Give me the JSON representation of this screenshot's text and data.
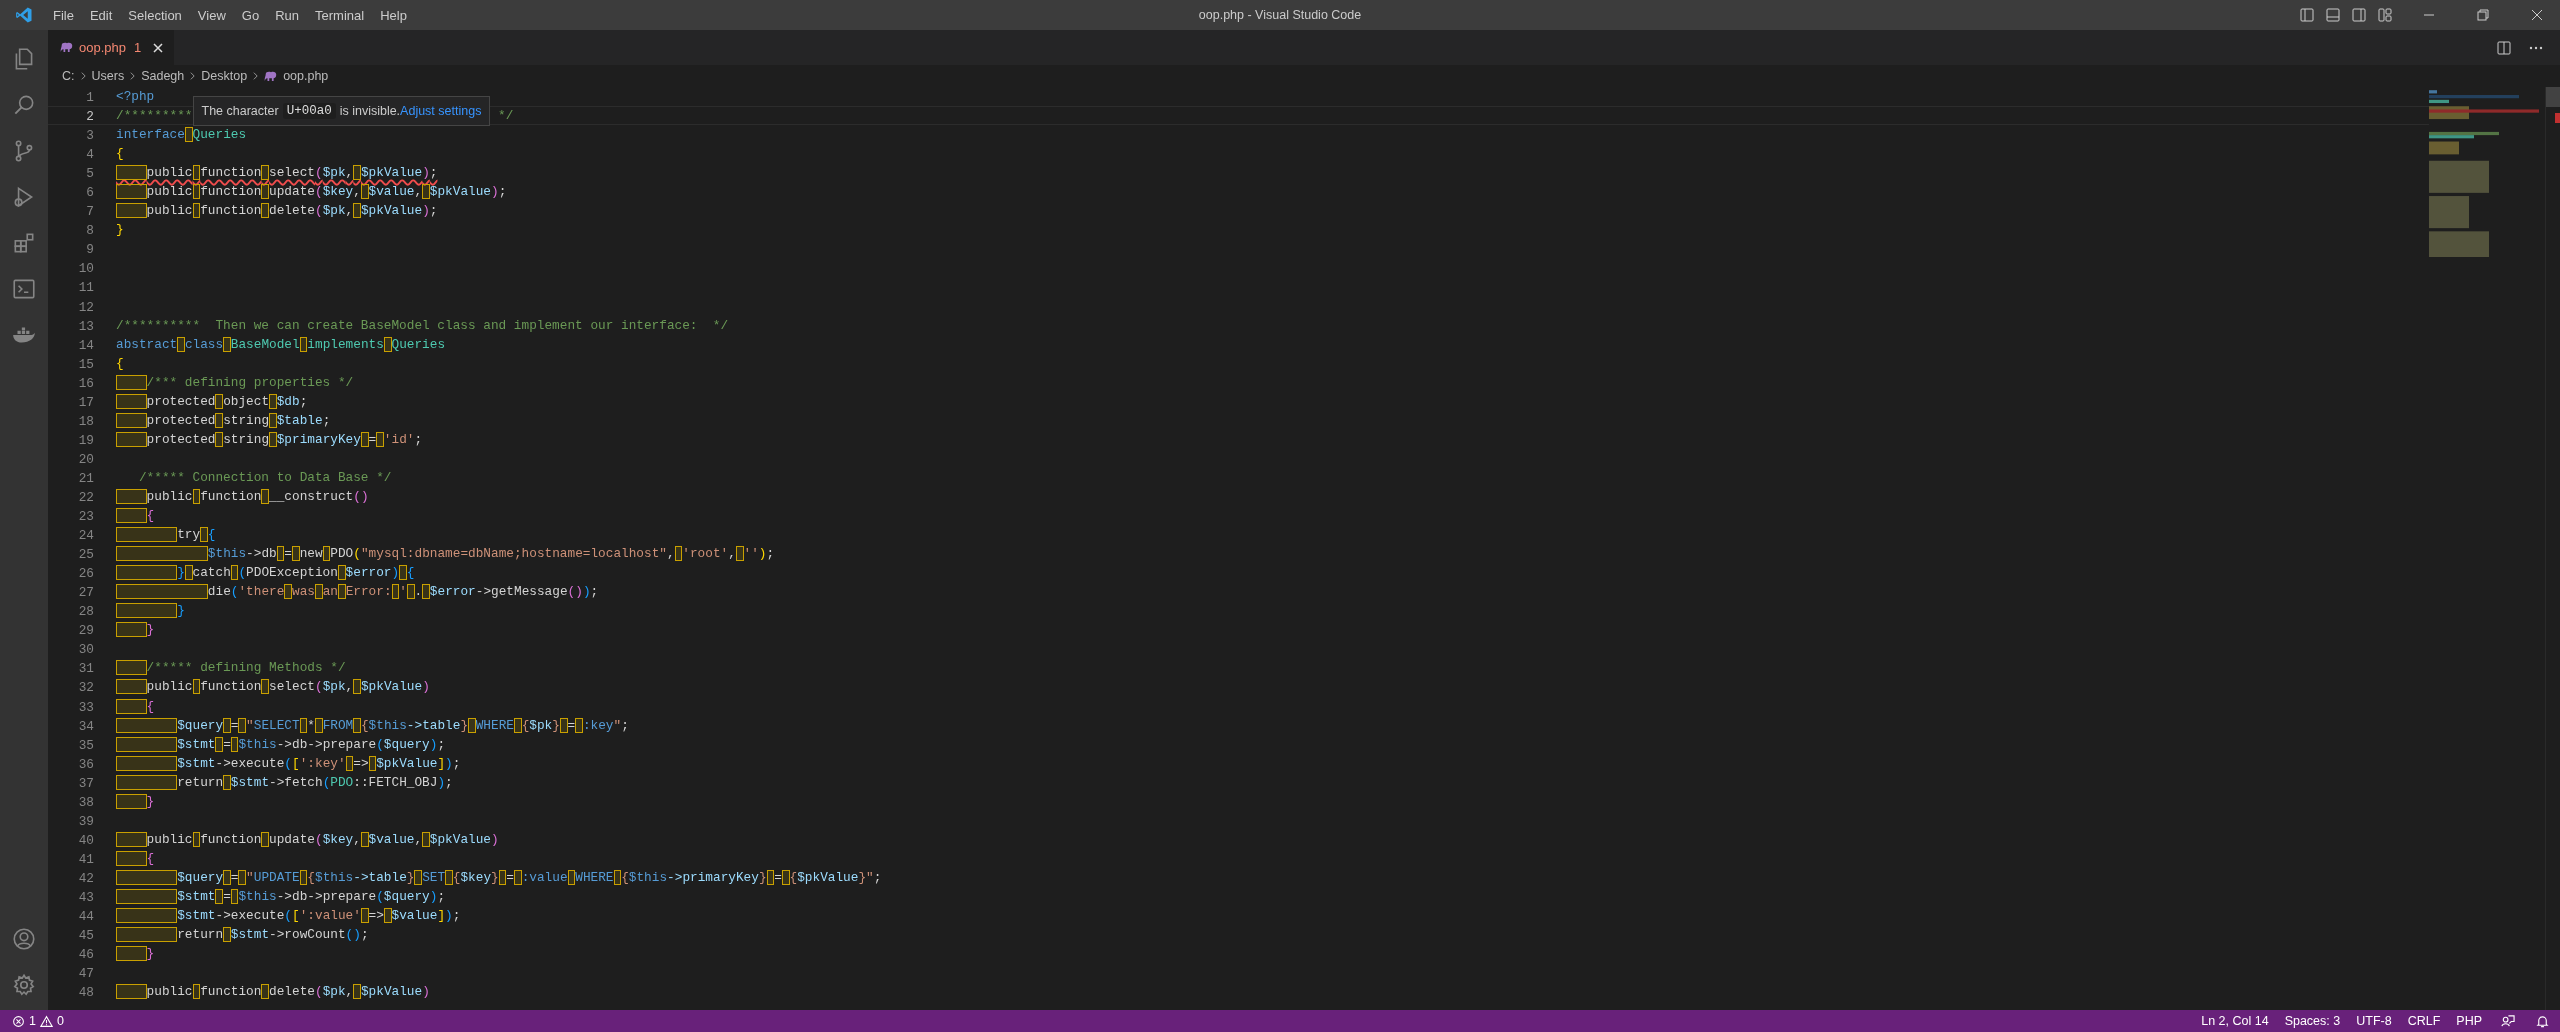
{
  "title_bar": {
    "menu": [
      "File",
      "Edit",
      "Selection",
      "View",
      "Go",
      "Run",
      "Terminal",
      "Help"
    ],
    "title": "oop.php - Visual Studio Code"
  },
  "tabs": [
    {
      "label": "oop.php",
      "problems": "1",
      "selected": true
    }
  ],
  "breadcrumb": [
    "C:",
    "Users",
    "Sadegh",
    "Desktop",
    "oop.php"
  ],
  "hover_tooltip": {
    "before": "The character",
    "code": "U+00a0",
    "after": "is invisible.",
    "link": "Adjust settings"
  },
  "editor": {
    "lines": [
      {
        "n": "1",
        "active": false,
        "error": false,
        "tokens": [
          {
            "kind": "kw",
            "t": "<?php"
          }
        ]
      },
      {
        "n": "2",
        "active": true,
        "error": false,
        "tokens": [
          {
            "kind": "com",
            "t": "/*********"
          },
          {
            "kind": "tooltip"
          },
          {
            "kind": "com",
            "t": " */"
          }
        ]
      },
      {
        "n": "3",
        "active": false,
        "error": false,
        "tokens": [
          {
            "kind": "kw",
            "t": "interface"
          },
          {
            "kind": "nb1"
          },
          {
            "kind": "ty",
            "t": "Queries"
          }
        ]
      },
      {
        "n": "4",
        "active": false,
        "error": false,
        "tokens": [
          {
            "kind": "b1",
            "t": "{"
          }
        ]
      },
      {
        "n": "5",
        "active": false,
        "error": true,
        "tokens": [
          {
            "kind": "nb4"
          },
          {
            "kind": "pl",
            "t": "public"
          },
          {
            "kind": "nb1"
          },
          {
            "kind": "pl",
            "t": "function"
          },
          {
            "kind": "nb1"
          },
          {
            "kind": "pl",
            "t": "select"
          },
          {
            "kind": "b2",
            "t": "("
          },
          {
            "kind": "var",
            "t": "$pk"
          },
          {
            "kind": "pl",
            "t": ","
          },
          {
            "kind": "nb1"
          },
          {
            "kind": "var",
            "t": "$pkValue"
          },
          {
            "kind": "b2",
            "t": ")"
          },
          {
            "kind": "pl",
            "t": ";"
          }
        ]
      },
      {
        "n": "6",
        "active": false,
        "error": false,
        "tokens": [
          {
            "kind": "nb4"
          },
          {
            "kind": "pl",
            "t": "public"
          },
          {
            "kind": "nb1"
          },
          {
            "kind": "pl",
            "t": "function"
          },
          {
            "kind": "nb1"
          },
          {
            "kind": "pl",
            "t": "update"
          },
          {
            "kind": "b2",
            "t": "("
          },
          {
            "kind": "var",
            "t": "$key"
          },
          {
            "kind": "pl",
            "t": ","
          },
          {
            "kind": "nb1"
          },
          {
            "kind": "var",
            "t": "$value"
          },
          {
            "kind": "pl",
            "t": ","
          },
          {
            "kind": "nb1"
          },
          {
            "kind": "var",
            "t": "$pkValue"
          },
          {
            "kind": "b2",
            "t": ")"
          },
          {
            "kind": "pl",
            "t": ";"
          }
        ]
      },
      {
        "n": "7",
        "active": false,
        "error": false,
        "tokens": [
          {
            "kind": "nb4"
          },
          {
            "kind": "pl",
            "t": "public"
          },
          {
            "kind": "nb1"
          },
          {
            "kind": "pl",
            "t": "function"
          },
          {
            "kind": "nb1"
          },
          {
            "kind": "pl",
            "t": "delete"
          },
          {
            "kind": "b2",
            "t": "("
          },
          {
            "kind": "var",
            "t": "$pk"
          },
          {
            "kind": "pl",
            "t": ","
          },
          {
            "kind": "nb1"
          },
          {
            "kind": "var",
            "t": "$pkValue"
          },
          {
            "kind": "b2",
            "t": ")"
          },
          {
            "kind": "pl",
            "t": ";"
          }
        ]
      },
      {
        "n": "8",
        "active": false,
        "error": false,
        "tokens": [
          {
            "kind": "b1",
            "t": "}"
          }
        ]
      },
      {
        "n": "9",
        "active": false,
        "error": false
      },
      {
        "n": "10",
        "active": false,
        "error": false
      },
      {
        "n": "11",
        "active": false,
        "error": false
      },
      {
        "n": "12",
        "active": false,
        "error": false
      },
      {
        "n": "13",
        "active": false,
        "error": false,
        "tokens": [
          {
            "kind": "com",
            "t": "/**********  Then we can create BaseModel class and implement our interface:  */"
          }
        ]
      },
      {
        "n": "14",
        "active": false,
        "error": false,
        "tokens": [
          {
            "kind": "kw",
            "t": "abstract"
          },
          {
            "kind": "nb1"
          },
          {
            "kind": "kw",
            "t": "class"
          },
          {
            "kind": "nb1"
          },
          {
            "kind": "ty",
            "t": "BaseModel"
          },
          {
            "kind": "nb1"
          },
          {
            "kind": "ty",
            "t": "implements"
          },
          {
            "kind": "nb1"
          },
          {
            "kind": "ty",
            "t": "Queries"
          }
        ]
      },
      {
        "n": "15",
        "active": false,
        "error": false,
        "tokens": [
          {
            "kind": "b1",
            "t": "{"
          }
        ]
      },
      {
        "n": "16",
        "active": false,
        "error": false,
        "tokens": [
          {
            "kind": "nb4"
          },
          {
            "kind": "com",
            "t": "/*** defining properties */"
          }
        ]
      },
      {
        "n": "17",
        "active": false,
        "error": false,
        "tokens": [
          {
            "kind": "nb4"
          },
          {
            "kind": "pl",
            "t": "protected"
          },
          {
            "kind": "nb1"
          },
          {
            "kind": "pl",
            "t": "object"
          },
          {
            "kind": "nb1"
          },
          {
            "kind": "var",
            "t": "$db"
          },
          {
            "kind": "pl",
            "t": ";"
          }
        ]
      },
      {
        "n": "18",
        "active": false,
        "error": false,
        "tokens": [
          {
            "kind": "nb4"
          },
          {
            "kind": "pl",
            "t": "protected"
          },
          {
            "kind": "nb1"
          },
          {
            "kind": "pl",
            "t": "string"
          },
          {
            "kind": "nb1"
          },
          {
            "kind": "var",
            "t": "$table"
          },
          {
            "kind": "pl",
            "t": ";"
          }
        ]
      },
      {
        "n": "19",
        "active": false,
        "error": false,
        "tokens": [
          {
            "kind": "nb4"
          },
          {
            "kind": "pl",
            "t": "protected"
          },
          {
            "kind": "nb1"
          },
          {
            "kind": "pl",
            "t": "string"
          },
          {
            "kind": "nb1"
          },
          {
            "kind": "var",
            "t": "$primaryKey"
          },
          {
            "kind": "nb1"
          },
          {
            "kind": "pl",
            "t": "="
          },
          {
            "kind": "nb1"
          },
          {
            "kind": "str",
            "t": "'id'"
          },
          {
            "kind": "pl",
            "t": ";"
          }
        ]
      },
      {
        "n": "20",
        "active": false,
        "error": false
      },
      {
        "n": "21",
        "active": false,
        "error": false,
        "tokens": [
          {
            "kind": "com",
            "t": "   /***** Connection to Data Base */"
          }
        ]
      },
      {
        "n": "22",
        "active": false,
        "error": false,
        "tokens": [
          {
            "kind": "nb4"
          },
          {
            "kind": "pl",
            "t": "public"
          },
          {
            "kind": "nb1"
          },
          {
            "kind": "pl",
            "t": "function"
          },
          {
            "kind": "nb1"
          },
          {
            "kind": "pl",
            "t": "__construct"
          },
          {
            "kind": "b2",
            "t": "()"
          }
        ]
      },
      {
        "n": "23",
        "active": false,
        "error": false,
        "tokens": [
          {
            "kind": "nb4"
          },
          {
            "kind": "b2",
            "t": "{"
          }
        ]
      },
      {
        "n": "24",
        "active": false,
        "error": false,
        "tokens": [
          {
            "kind": "nb8"
          },
          {
            "kind": "pl",
            "t": "try"
          },
          {
            "kind": "nb1"
          },
          {
            "kind": "b3",
            "t": "{"
          }
        ]
      },
      {
        "n": "25",
        "active": false,
        "error": false,
        "tokens": [
          {
            "kind": "nb12"
          },
          {
            "kind": "kw",
            "t": "$this"
          },
          {
            "kind": "pl",
            "t": "->db"
          },
          {
            "kind": "nb1"
          },
          {
            "kind": "pl",
            "t": "="
          },
          {
            "kind": "nb1"
          },
          {
            "kind": "pl",
            "t": "new"
          },
          {
            "kind": "nb1"
          },
          {
            "kind": "pl",
            "t": "PDO"
          },
          {
            "kind": "b1",
            "t": "("
          },
          {
            "kind": "str",
            "t": "\"mysql:dbname=dbName;hostname=localhost\""
          },
          {
            "kind": "pl",
            "t": ","
          },
          {
            "kind": "nb1"
          },
          {
            "kind": "str",
            "t": "'root'"
          },
          {
            "kind": "pl",
            "t": ","
          },
          {
            "kind": "nb1"
          },
          {
            "kind": "str",
            "t": "''"
          },
          {
            "kind": "b1",
            "t": ")"
          },
          {
            "kind": "pl",
            "t": ";"
          }
        ]
      },
      {
        "n": "26",
        "active": false,
        "error": false,
        "tokens": [
          {
            "kind": "nb8"
          },
          {
            "kind": "b3",
            "t": "}"
          },
          {
            "kind": "nb1"
          },
          {
            "kind": "pl",
            "t": "catch"
          },
          {
            "kind": "nb1"
          },
          {
            "kind": "b3",
            "t": "("
          },
          {
            "kind": "pl",
            "t": "PDOException"
          },
          {
            "kind": "nb1"
          },
          {
            "kind": "var",
            "t": "$error"
          },
          {
            "kind": "b3",
            "t": ")"
          },
          {
            "kind": "nb1"
          },
          {
            "kind": "b3",
            "t": "{"
          }
        ]
      },
      {
        "n": "27",
        "active": false,
        "error": false,
        "tokens": [
          {
            "kind": "nb12"
          },
          {
            "kind": "pl",
            "t": "die"
          },
          {
            "kind": "b3",
            "t": "("
          },
          {
            "kind": "str",
            "t": "'there"
          },
          {
            "kind": "nb1"
          },
          {
            "kind": "str",
            "t": "was"
          },
          {
            "kind": "nb1"
          },
          {
            "kind": "str",
            "t": "an"
          },
          {
            "kind": "nb1"
          },
          {
            "kind": "str",
            "t": "Error:"
          },
          {
            "kind": "nb1"
          },
          {
            "kind": "str",
            "t": "'"
          },
          {
            "kind": "nb1"
          },
          {
            "kind": "pl",
            "t": "."
          },
          {
            "kind": "nb1"
          },
          {
            "kind": "var",
            "t": "$error"
          },
          {
            "kind": "pl",
            "t": "->getMessage"
          },
          {
            "kind": "b2",
            "t": "()"
          },
          {
            "kind": "b3",
            "t": ")"
          },
          {
            "kind": "pl",
            "t": ";"
          }
        ]
      },
      {
        "n": "28",
        "active": false,
        "error": false,
        "tokens": [
          {
            "kind": "nb8"
          },
          {
            "kind": "b3",
            "t": "}"
          }
        ]
      },
      {
        "n": "29",
        "active": false,
        "error": false,
        "tokens": [
          {
            "kind": "nb4"
          },
          {
            "kind": "b2",
            "t": "}"
          }
        ]
      },
      {
        "n": "30",
        "active": false,
        "error": false
      },
      {
        "n": "31",
        "active": false,
        "error": false,
        "tokens": [
          {
            "kind": "nb4"
          },
          {
            "kind": "com",
            "t": "/***** defining Methods */"
          }
        ]
      },
      {
        "n": "32",
        "active": false,
        "error": false,
        "tokens": [
          {
            "kind": "nb4"
          },
          {
            "kind": "pl",
            "t": "public"
          },
          {
            "kind": "nb1"
          },
          {
            "kind": "pl",
            "t": "function"
          },
          {
            "kind": "nb1"
          },
          {
            "kind": "pl",
            "t": "select"
          },
          {
            "kind": "b2",
            "t": "("
          },
          {
            "kind": "var",
            "t": "$pk"
          },
          {
            "kind": "pl",
            "t": ","
          },
          {
            "kind": "nb1"
          },
          {
            "kind": "var",
            "t": "$pkValue"
          },
          {
            "kind": "b2",
            "t": ")"
          }
        ]
      },
      {
        "n": "33",
        "active": false,
        "error": false,
        "tokens": [
          {
            "kind": "nb4"
          },
          {
            "kind": "b2",
            "t": "{"
          }
        ]
      },
      {
        "n": "34",
        "active": false,
        "error": false,
        "tokens": [
          {
            "kind": "nb8"
          },
          {
            "kind": "var",
            "t": "$query"
          },
          {
            "kind": "nb1"
          },
          {
            "kind": "pl",
            "t": "="
          },
          {
            "kind": "nb1"
          },
          {
            "kind": "str",
            "t": "\""
          },
          {
            "kind": "kw",
            "t": "SELECT"
          },
          {
            "kind": "nb1"
          },
          {
            "kind": "pl",
            "t": "*"
          },
          {
            "kind": "nb1"
          },
          {
            "kind": "kw",
            "t": "FROM"
          },
          {
            "kind": "nb1"
          },
          {
            "kind": "str",
            "t": "{"
          },
          {
            "kind": "kw",
            "t": "$this"
          },
          {
            "kind": "var",
            "t": "->table"
          },
          {
            "kind": "str",
            "t": "}"
          },
          {
            "kind": "nb1"
          },
          {
            "kind": "kw",
            "t": "WHERE"
          },
          {
            "kind": "nb1"
          },
          {
            "kind": "str",
            "t": "{"
          },
          {
            "kind": "var",
            "t": "$pk"
          },
          {
            "kind": "str",
            "t": "}"
          },
          {
            "kind": "nb1"
          },
          {
            "kind": "pl",
            "t": "="
          },
          {
            "kind": "nb1"
          },
          {
            "kind": "kw",
            "t": ":key"
          },
          {
            "kind": "str",
            "t": "\""
          },
          {
            "kind": "pl",
            "t": ";"
          }
        ]
      },
      {
        "n": "35",
        "active": false,
        "error": false,
        "tokens": [
          {
            "kind": "nb8"
          },
          {
            "kind": "var",
            "t": "$stmt"
          },
          {
            "kind": "nb1"
          },
          {
            "kind": "pl",
            "t": "="
          },
          {
            "kind": "nb1"
          },
          {
            "kind": "kw",
            "t": "$this"
          },
          {
            "kind": "pl",
            "t": "->db->prepare"
          },
          {
            "kind": "b3",
            "t": "("
          },
          {
            "kind": "var",
            "t": "$query"
          },
          {
            "kind": "b3",
            "t": ")"
          },
          {
            "kind": "pl",
            "t": ";"
          }
        ]
      },
      {
        "n": "36",
        "active": false,
        "error": false,
        "tokens": [
          {
            "kind": "nb8"
          },
          {
            "kind": "var",
            "t": "$stmt"
          },
          {
            "kind": "pl",
            "t": "->execute"
          },
          {
            "kind": "b3",
            "t": "("
          },
          {
            "kind": "b1",
            "t": "["
          },
          {
            "kind": "str",
            "t": "':key'"
          },
          {
            "kind": "nb1"
          },
          {
            "kind": "pl",
            "t": "=>"
          },
          {
            "kind": "nb1"
          },
          {
            "kind": "var",
            "t": "$pkValue"
          },
          {
            "kind": "b1",
            "t": "]"
          },
          {
            "kind": "b3",
            "t": ")"
          },
          {
            "kind": "pl",
            "t": ";"
          }
        ]
      },
      {
        "n": "37",
        "active": false,
        "error": false,
        "tokens": [
          {
            "kind": "nb8"
          },
          {
            "kind": "pl",
            "t": "return"
          },
          {
            "kind": "nb1"
          },
          {
            "kind": "var",
            "t": "$stmt"
          },
          {
            "kind": "pl",
            "t": "->fetch"
          },
          {
            "kind": "b3",
            "t": "("
          },
          {
            "kind": "ty",
            "t": "PDO"
          },
          {
            "kind": "pl",
            "t": "::FETCH_OBJ"
          },
          {
            "kind": "b3",
            "t": ")"
          },
          {
            "kind": "pl",
            "t": ";"
          }
        ]
      },
      {
        "n": "38",
        "active": false,
        "error": false,
        "tokens": [
          {
            "kind": "nb4"
          },
          {
            "kind": "b2",
            "t": "}"
          }
        ]
      },
      {
        "n": "39",
        "active": false,
        "error": false
      },
      {
        "n": "40",
        "active": false,
        "error": false,
        "tokens": [
          {
            "kind": "nb4"
          },
          {
            "kind": "pl",
            "t": "public"
          },
          {
            "kind": "nb1"
          },
          {
            "kind": "pl",
            "t": "function"
          },
          {
            "kind": "nb1"
          },
          {
            "kind": "pl",
            "t": "update"
          },
          {
            "kind": "b2",
            "t": "("
          },
          {
            "kind": "var",
            "t": "$key"
          },
          {
            "kind": "pl",
            "t": ","
          },
          {
            "kind": "nb1"
          },
          {
            "kind": "var",
            "t": "$value"
          },
          {
            "kind": "pl",
            "t": ","
          },
          {
            "kind": "nb1"
          },
          {
            "kind": "var",
            "t": "$pkValue"
          },
          {
            "kind": "b2",
            "t": ")"
          }
        ]
      },
      {
        "n": "41",
        "active": false,
        "error": false,
        "tokens": [
          {
            "kind": "nb4"
          },
          {
            "kind": "b2",
            "t": "{"
          }
        ]
      },
      {
        "n": "42",
        "active": false,
        "error": false,
        "tokens": [
          {
            "kind": "nb8"
          },
          {
            "kind": "var",
            "t": "$query"
          },
          {
            "kind": "nb1"
          },
          {
            "kind": "pl",
            "t": "="
          },
          {
            "kind": "nb1"
          },
          {
            "kind": "str",
            "t": "\""
          },
          {
            "kind": "kw",
            "t": "UPDATE"
          },
          {
            "kind": "nb1"
          },
          {
            "kind": "str",
            "t": "{"
          },
          {
            "kind": "kw",
            "t": "$this"
          },
          {
            "kind": "var",
            "t": "->table"
          },
          {
            "kind": "str",
            "t": "}"
          },
          {
            "kind": "nb1"
          },
          {
            "kind": "kw",
            "t": "SET"
          },
          {
            "kind": "nb1"
          },
          {
            "kind": "str",
            "t": "{"
          },
          {
            "kind": "var",
            "t": "$key"
          },
          {
            "kind": "str",
            "t": "}"
          },
          {
            "kind": "nb1"
          },
          {
            "kind": "pl",
            "t": "="
          },
          {
            "kind": "nb1"
          },
          {
            "kind": "kw",
            "t": ":value"
          },
          {
            "kind": "nb1"
          },
          {
            "kind": "kw",
            "t": "WHERE"
          },
          {
            "kind": "nb1"
          },
          {
            "kind": "str",
            "t": "{"
          },
          {
            "kind": "kw",
            "t": "$this"
          },
          {
            "kind": "var",
            "t": "->primaryKey"
          },
          {
            "kind": "str",
            "t": "}"
          },
          {
            "kind": "nb1"
          },
          {
            "kind": "pl",
            "t": "="
          },
          {
            "kind": "nb1"
          },
          {
            "kind": "str",
            "t": "{"
          },
          {
            "kind": "var",
            "t": "$pkValue"
          },
          {
            "kind": "str",
            "t": "}\""
          },
          {
            "kind": "pl",
            "t": ";"
          }
        ]
      },
      {
        "n": "43",
        "active": false,
        "error": false,
        "tokens": [
          {
            "kind": "nb8"
          },
          {
            "kind": "var",
            "t": "$stmt"
          },
          {
            "kind": "nb1"
          },
          {
            "kind": "pl",
            "t": "="
          },
          {
            "kind": "nb1"
          },
          {
            "kind": "kw",
            "t": "$this"
          },
          {
            "kind": "pl",
            "t": "->db->prepare"
          },
          {
            "kind": "b3",
            "t": "("
          },
          {
            "kind": "var",
            "t": "$query"
          },
          {
            "kind": "b3",
            "t": ")"
          },
          {
            "kind": "pl",
            "t": ";"
          }
        ]
      },
      {
        "n": "44",
        "active": false,
        "error": false,
        "tokens": [
          {
            "kind": "nb8"
          },
          {
            "kind": "var",
            "t": "$stmt"
          },
          {
            "kind": "pl",
            "t": "->execute"
          },
          {
            "kind": "b3",
            "t": "("
          },
          {
            "kind": "b1",
            "t": "["
          },
          {
            "kind": "str",
            "t": "':value'"
          },
          {
            "kind": "nb1"
          },
          {
            "kind": "pl",
            "t": "=>"
          },
          {
            "kind": "nb1"
          },
          {
            "kind": "var",
            "t": "$value"
          },
          {
            "kind": "b1",
            "t": "]"
          },
          {
            "kind": "b3",
            "t": ")"
          },
          {
            "kind": "pl",
            "t": ";"
          }
        ]
      },
      {
        "n": "45",
        "active": false,
        "error": false,
        "tokens": [
          {
            "kind": "nb8"
          },
          {
            "kind": "pl",
            "t": "return"
          },
          {
            "kind": "nb1"
          },
          {
            "kind": "var",
            "t": "$stmt"
          },
          {
            "kind": "pl",
            "t": "->rowCount"
          },
          {
            "kind": "b3",
            "t": "()"
          },
          {
            "kind": "pl",
            "t": ";"
          }
        ]
      },
      {
        "n": "46",
        "active": false,
        "error": false,
        "tokens": [
          {
            "kind": "nb4"
          },
          {
            "kind": "b2",
            "t": "}"
          }
        ]
      },
      {
        "n": "47",
        "active": false,
        "error": false
      },
      {
        "n": "48",
        "active": false,
        "error": false,
        "tokens": [
          {
            "kind": "nb4"
          },
          {
            "kind": "pl",
            "t": "public"
          },
          {
            "kind": "nb1"
          },
          {
            "kind": "pl",
            "t": "function"
          },
          {
            "kind": "nb1"
          },
          {
            "kind": "pl",
            "t": "delete"
          },
          {
            "kind": "b2",
            "t": "("
          },
          {
            "kind": "var",
            "t": "$pk"
          },
          {
            "kind": "pl",
            "t": ","
          },
          {
            "kind": "nb1"
          },
          {
            "kind": "var",
            "t": "$pkValue"
          },
          {
            "kind": "b2",
            "t": ")"
          }
        ]
      }
    ]
  },
  "status_bar": {
    "errors": "1",
    "warnings": "0",
    "items": [
      "Ln 2, Col 14",
      "Spaces: 3",
      "UTF-8",
      "CRLF",
      "PHP"
    ]
  }
}
